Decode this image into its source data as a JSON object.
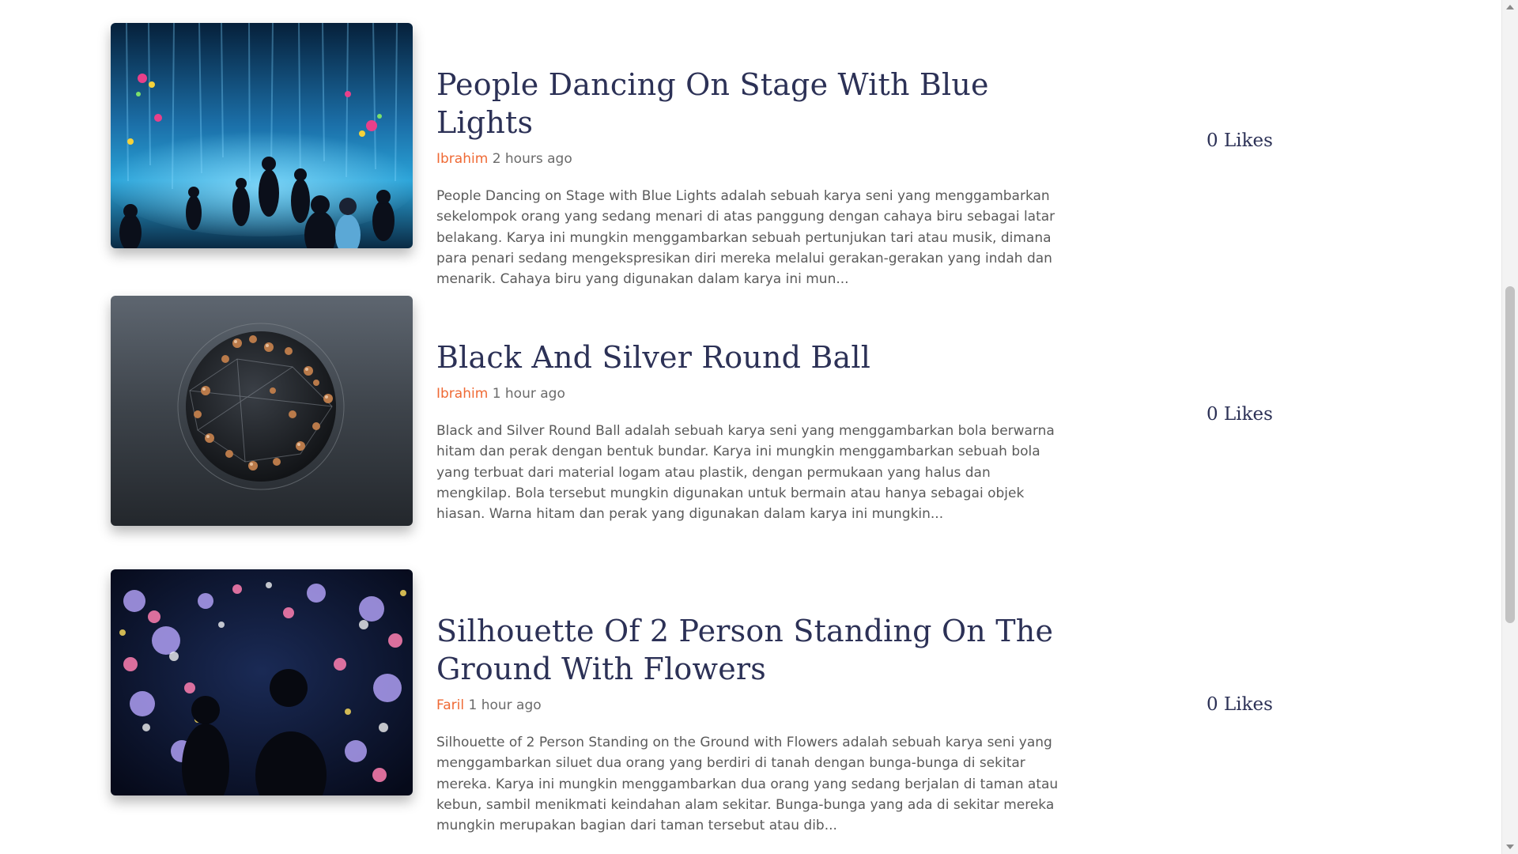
{
  "posts": [
    {
      "title": "People Dancing On Stage With Blue Lights",
      "author": "Ibrahim",
      "time": "2 hours ago",
      "excerpt": "People Dancing on Stage with Blue Lights adalah sebuah karya seni yang menggambarkan sekelompok orang yang sedang menari di atas panggung dengan cahaya biru sebagai latar belakang. Karya ini mungkin menggambarkan sebuah pertunjukan tari atau musik, dimana para penari sedang mengekspresikan diri mereka melalui gerakan-gerakan yang indah dan menarik. Cahaya biru yang digunakan dalam karya ini mun...",
      "likes": "0 Likes"
    },
    {
      "title": "Black And Silver Round Ball",
      "author": "Ibrahim",
      "time": "1 hour ago",
      "excerpt": "Black and Silver Round Ball adalah sebuah karya seni yang menggambarkan bola berwarna hitam dan perak dengan bentuk bundar. Karya ini mungkin menggambarkan sebuah bola yang terbuat dari material logam atau plastik, dengan permukaan yang halus dan mengkilap. Bola tersebut mungkin digunakan untuk bermain atau hanya sebagai objek hiasan. Warna hitam dan perak yang digunakan dalam karya ini mungkin...",
      "likes": "0 Likes"
    },
    {
      "title": "Silhouette Of 2 Person Standing On The Ground With Flowers",
      "author": "Faril",
      "time": "1 hour ago",
      "excerpt": "Silhouette of 2 Person Standing on the Ground with Flowers adalah sebuah karya seni yang menggambarkan siluet dua orang yang berdiri di tanah dengan bunga-bunga di sekitar mereka. Karya ini mungkin menggambarkan dua orang yang sedang berjalan di taman atau kebun, sambil menikmati keindahan alam sekitar. Bunga-bunga yang ada di sekitar mereka mungkin merupakan bagian dari taman tersebut atau dib...",
      "likes": "0 Likes"
    }
  ],
  "colors": {
    "title": "#2c3156",
    "author": "#ef6a35",
    "meta": "#6b6b6b",
    "excerpt": "#5a5a5a"
  }
}
